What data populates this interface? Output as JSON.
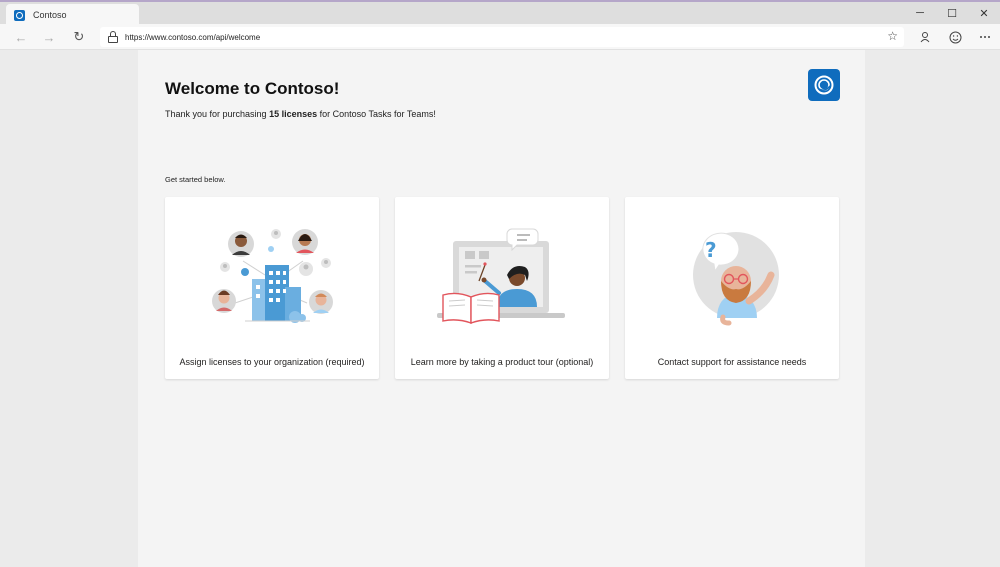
{
  "browser": {
    "tab_title": "Contoso",
    "url": "https://www.contoso.com/api/welcome",
    "window_controls": {
      "minimize": "─",
      "maximize": "☐",
      "close": "✕"
    },
    "nav": {
      "back": "←",
      "forward": "→",
      "refresh": "↻"
    },
    "icons": [
      "back-icon",
      "forward-icon",
      "refresh-icon",
      "lock-icon",
      "favorite-star-icon",
      "profile-icon",
      "feedback-smiley-icon",
      "more-icon"
    ]
  },
  "page": {
    "title": "Welcome to Contoso!",
    "subtitle_prefix": "Thank you for purchasing ",
    "subtitle_bold": "15 licenses",
    "subtitle_suffix": " for Contoso Tasks for Teams!",
    "get_started": "Get started below."
  },
  "cards": [
    {
      "label": "Assign licenses to your organization (required)"
    },
    {
      "label": "Learn more by taking a product tour (optional)"
    },
    {
      "label": "Contact support for assistance needs"
    }
  ],
  "colors": {
    "brand": "#0f6cbd",
    "page_background": "#f4f4f4",
    "card_background": "#ffffff"
  }
}
